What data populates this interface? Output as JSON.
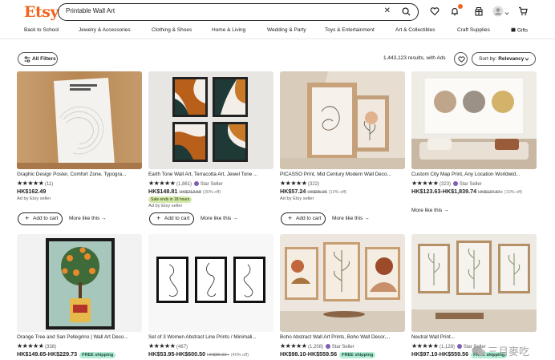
{
  "brand": {
    "logo": "Etsy",
    "accent": "#F1641E"
  },
  "search": {
    "value": "Printable Wall Art",
    "clear_icon": "close-icon",
    "icon": "search-icon"
  },
  "header_icons": [
    "heart-icon",
    "bell-icon",
    "gift-icon",
    "avatar",
    "cart-icon"
  ],
  "nav": [
    "Back to School",
    "Jewelry & Accessories",
    "Clothing & Shoes",
    "Home & Living",
    "Wedding & Party",
    "Toys & Entertainment",
    "Art & Collectibles",
    "Craft Supplies",
    "Gifts"
  ],
  "filter_bar": {
    "all_filters": "All Filters",
    "results": "1,443,123 results, with Ads",
    "sort_label": "Sort by: ",
    "sort_value": "Relevancy"
  },
  "products": [
    {
      "title": "Graphic Design Poster, Comfort Zone, Typogra...",
      "rating_count": "(11)",
      "star_seller": "",
      "price": "HK$162.49",
      "was": "",
      "off": "",
      "free_shipping": "",
      "badge": "",
      "ad": "Ad by Etsy seller",
      "add_to_cart": "Add to cart",
      "more_like_this": "More like this"
    },
    {
      "title": "Earth Tone Wall Art, Terracotta Art, Jewel Tone ...",
      "rating_count": "(1,861)",
      "star_seller": "Star Seller",
      "price": "HK$148.81",
      "was": "HK$212.58",
      "off": "(30% off)",
      "free_shipping": "",
      "badge": "Sale ends in 18 hours",
      "ad": "Ad by Etsy seller",
      "add_to_cart": "Add to cart",
      "more_like_this": "More like this"
    },
    {
      "title": "PICASSO Print, Mid Century Modern Wall Deco...",
      "rating_count": "(322)",
      "star_seller": "",
      "price": "HK$57.24",
      "was": "HK$95.06",
      "off": "(10% off)",
      "free_shipping": "",
      "badge": "",
      "ad": "Ad by Etsy seller",
      "add_to_cart": "Add to cart",
      "more_like_this": "More like this"
    },
    {
      "title": "Custom City Map Print, Any Location Worldwid...",
      "rating_count": "(323)",
      "star_seller": "Star Seller",
      "price": "HK$123.63-HK$1,839.74",
      "was": "HK$137.37+",
      "off": "(10% off)",
      "free_shipping": "",
      "badge": "",
      "ad": "",
      "add_to_cart": "",
      "more_like_this": "More like this"
    },
    {
      "title": "Orange Tree and San Pellegrino | Wall Art Deco...",
      "rating_count": "(338)",
      "star_seller": "",
      "price": "HK$149.65-HK$229.73",
      "was": "",
      "off": "",
      "free_shipping": "FREE shipping",
      "badge": "",
      "ad": "",
      "add_to_cart": "",
      "more_like_this": ""
    },
    {
      "title": "Set of 3 Women Abstract Line Prints / Minimali...",
      "rating_count": "(467)",
      "star_seller": "",
      "price": "HK$53.95-HK$600.50",
      "was": "HK$89.92+",
      "off": "(40% off)",
      "free_shipping": "",
      "badge": "",
      "ad": "",
      "add_to_cart": "",
      "more_like_this": ""
    },
    {
      "title": "Boho Abstract Wall Art Prints, Boho Wall Decor,...",
      "rating_count": "(1,208)",
      "star_seller": "Star Seller",
      "price": "HK$98.10-HK$559.56",
      "was": "",
      "off": "",
      "free_shipping": "FREE shipping",
      "badge": "",
      "ad": "",
      "add_to_cart": "",
      "more_like_this": ""
    },
    {
      "title": "Neutral Wall Print...",
      "rating_count": "(1,128)",
      "star_seller": "Star Seller",
      "price": "HK$97.10-HK$559.56",
      "was": "",
      "off": "",
      "free_shipping": "FREE shipping",
      "badge": "",
      "ad": "",
      "add_to_cart": "",
      "more_like_this": ""
    }
  ],
  "watermark": "三月麥吃",
  "colors": {
    "free_shipping_bg": "#b4ecd5",
    "sale_badge_bg": "#d4e9a9",
    "star_seller": "#7f5fb5"
  }
}
